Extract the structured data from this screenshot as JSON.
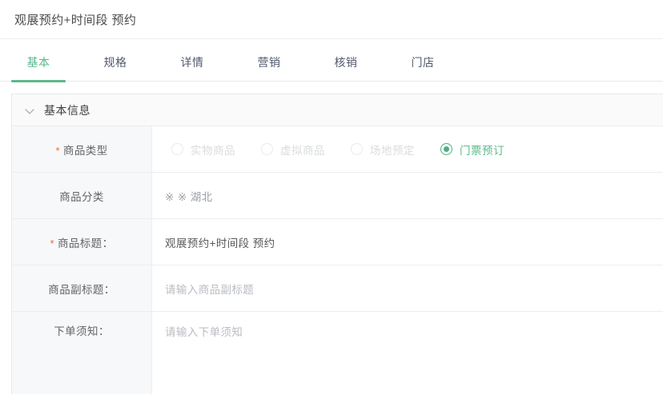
{
  "header": {
    "title": "观展预约+时间段 预约"
  },
  "tabs": {
    "items": [
      {
        "label": "基本",
        "active": true
      },
      {
        "label": "规格",
        "active": false
      },
      {
        "label": "详情",
        "active": false
      },
      {
        "label": "营销",
        "active": false
      },
      {
        "label": "核销",
        "active": false
      },
      {
        "label": "门店",
        "active": false
      }
    ],
    "active_color": "#5cb98b"
  },
  "section": {
    "title": "基本信息",
    "collapse_icon": "chevron-down-icon"
  },
  "form": {
    "rows": [
      {
        "label": "商品类型",
        "required": true,
        "type": "radio-group"
      },
      {
        "label": "商品分类",
        "required": false,
        "type": "text",
        "value": "※ ※ 湖北"
      },
      {
        "label": "商品标题：",
        "required": true,
        "type": "text",
        "value": "观展预约+时间段 预约"
      },
      {
        "label": "商品副标题：",
        "required": false,
        "type": "input",
        "value": "",
        "placeholder": "请输入商品副标题"
      },
      {
        "label": "下单须知：",
        "required": false,
        "type": "textarea",
        "value": "",
        "placeholder": "请输入下单须知"
      }
    ]
  },
  "product_type": {
    "options": [
      {
        "label": "实物商品",
        "selected": false,
        "disabled": true
      },
      {
        "label": "虚拟商品",
        "selected": false,
        "disabled": true
      },
      {
        "label": "场地预定",
        "selected": false,
        "disabled": true
      },
      {
        "label": "门票预订",
        "selected": true,
        "disabled": false
      }
    ],
    "selected_value": "门票预订",
    "selected_color": "#4caf7d",
    "disabled_color": "#dadcde"
  },
  "colors": {
    "accent": "#5cb98b",
    "required_star": "#e8683b",
    "label_bg": "#f7f8f9",
    "border": "#ededed",
    "text": "#606266",
    "placeholder": "#b9bcc2"
  }
}
